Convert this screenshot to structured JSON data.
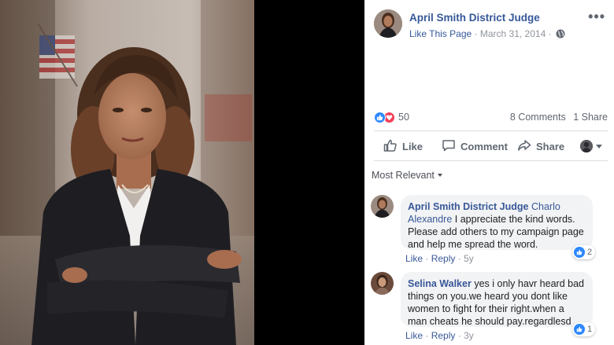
{
  "post": {
    "author": "April Smith District Judge",
    "like_page": "Like This Page",
    "separator": "·",
    "date": "March 31, 2014",
    "separator2": "·",
    "more": "•••"
  },
  "stats": {
    "reaction_count": "50",
    "comments": "8 Comments",
    "shares": "1 Share"
  },
  "actions": {
    "like": "Like",
    "comment": "Comment",
    "share": "Share"
  },
  "sort": {
    "label": "Most Relevant"
  },
  "comments": [
    {
      "author": "April Smith District Judge",
      "mention": "Charlo Alexandre",
      "text": "I appreciate the kind words. Please add others to my campaign page and help me spread the word.",
      "like": "Like",
      "reply": "Reply",
      "age": "5y",
      "reactions": "2",
      "dot": "·",
      "dot2": "·"
    },
    {
      "author": "Selina Walker",
      "mention": "",
      "text": "yes i only havr heard bad things on you.we heard you dont like women to fight for their right.when a man cheats he should pay.regardlesd",
      "like": "Like",
      "reply": "Reply",
      "age": "3y",
      "reactions": "1",
      "dot": "·",
      "dot2": "·"
    }
  ],
  "colors": {
    "link": "#365899",
    "meta": "#90949c",
    "like_blue": "#2d88ff",
    "love_red": "#f33e58",
    "bubble": "#f2f3f5"
  },
  "icons": [
    "globe-icon",
    "like-thumb-icon",
    "love-heart-icon",
    "comment-icon",
    "share-icon",
    "more-icon",
    "caret-down-icon"
  ]
}
